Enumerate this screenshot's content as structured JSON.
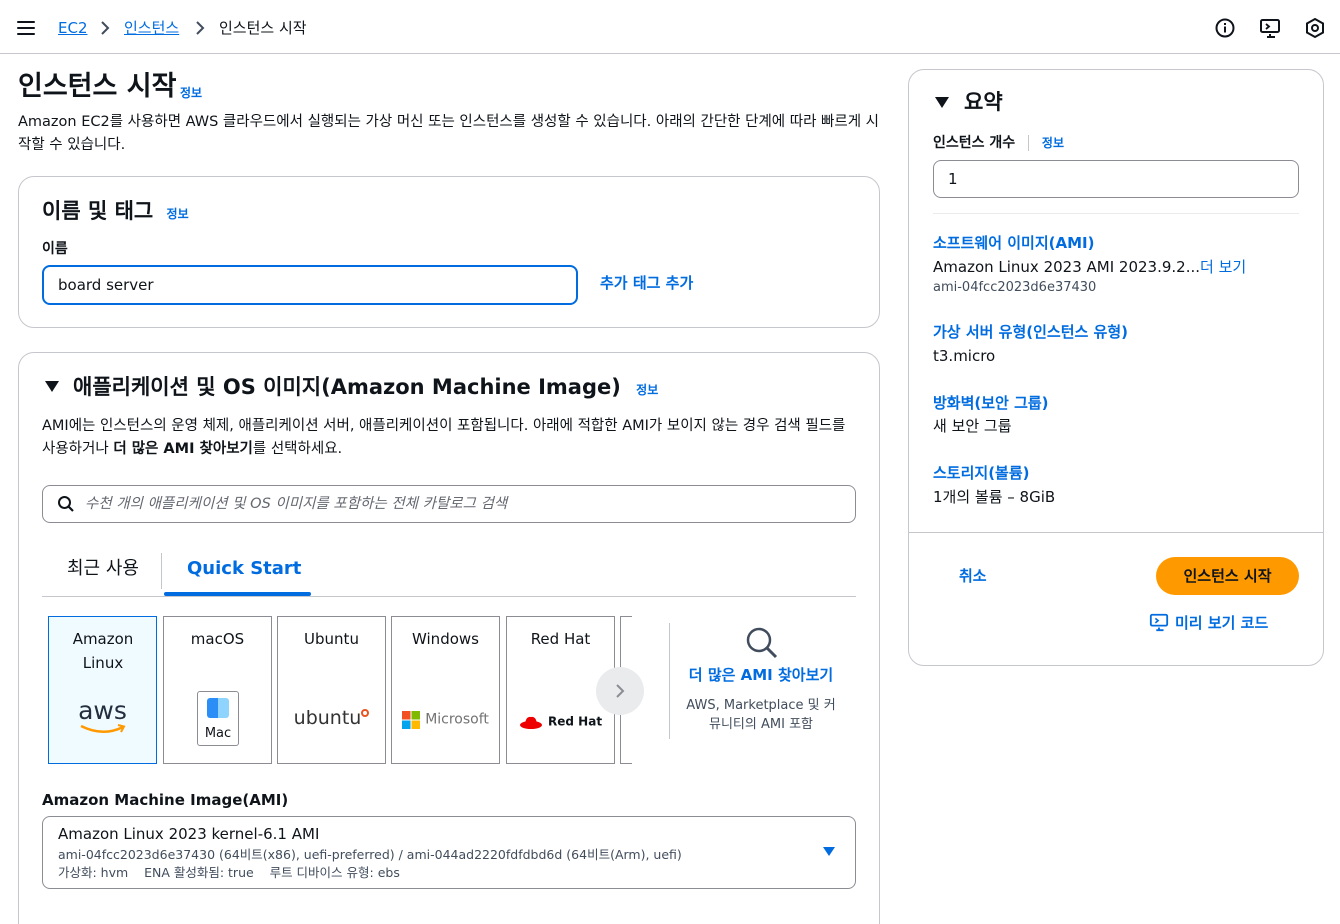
{
  "breadcrumb": {
    "items": [
      "EC2",
      "인스턴스",
      "인스턴스 시작"
    ]
  },
  "page": {
    "title": "인스턴스 시작",
    "info": "정보",
    "description": "Amazon EC2를 사용하면 AWS 클라우드에서 실행되는 가상 머신 또는 인스턴스를 생성할 수 있습니다. 아래의 간단한 단계에 따라 빠르게 시작할 수 있습니다."
  },
  "name_section": {
    "title": "이름 및 태그",
    "info": "정보",
    "name_label": "이름",
    "name_value": "board server",
    "add_tags": "추가 태그 추가"
  },
  "ami_section": {
    "title": "애플리케이션 및 OS 이미지(Amazon Machine Image)",
    "info": "정보",
    "desc_part1": "AMI에는 인스턴스의 운영 체제, 애플리케이션 서버, 애플리케이션이 포함됩니다. 아래에 적합한 AMI가 보이지 않는 경우 검색 필드를 사용하거나 ",
    "desc_bold": "더 많은 AMI 찾아보기",
    "desc_part2": "를 선택하세요.",
    "search_placeholder": "수천 개의 애플리케이션 및 OS 이미지를 포함하는 전체 카탈로그 검색",
    "tabs": [
      "최근 사용",
      "Quick Start"
    ],
    "os_cards": [
      {
        "name": "Amazon Linux",
        "logo": "aws"
      },
      {
        "name": "macOS",
        "logo": "Mac"
      },
      {
        "name": "Ubuntu",
        "logo": "ubuntu"
      },
      {
        "name": "Windows",
        "logo": "Microsoft"
      },
      {
        "name": "Red Hat",
        "logo": "Red Hat"
      }
    ],
    "more_ami": "더 많은 AMI 찾아보기",
    "more_ami_sub": "AWS, Marketplace 및 커뮤니티의 AMI 포함",
    "ami_label": "Amazon Machine Image(AMI)",
    "ami_name": "Amazon Linux 2023 kernel-6.1 AMI",
    "ami_ids": "ami-04fcc2023d6e37430 (64비트(x86), uefi-preferred) / ami-044ad2220fdfdbd6d (64비트(Arm), uefi)",
    "ami_meta": "가상화: hvm    ENA 활성화됨: true    루트 디바이스 유형: ebs"
  },
  "summary": {
    "title": "요약",
    "count_label": "인스턴스 개수",
    "info": "정보",
    "count_value": "1",
    "ami_label": "소프트웨어 이미지(AMI)",
    "ami_value": "Amazon Linux 2023 AMI 2023.9.2...",
    "ami_more": "더 보기",
    "ami_id": "ami-04fcc2023d6e37430",
    "type_label": "가상 서버 유형(인스턴스 유형)",
    "type_value": "t3.micro",
    "firewall_label": "방화벽(보안 그룹)",
    "firewall_value": "새 보안 그룹",
    "storage_label": "스토리지(볼륨)",
    "storage_value": "1개의 볼륨 – 8GiB",
    "cancel": "취소",
    "launch": "인스턴스 시작",
    "preview_code": "미리 보기 코드"
  },
  "colors": {
    "accent": "#006ce0",
    "launch_button": "#ff9900",
    "selected_card_bg": "#f0fbff",
    "border": "#c6c6cd"
  }
}
